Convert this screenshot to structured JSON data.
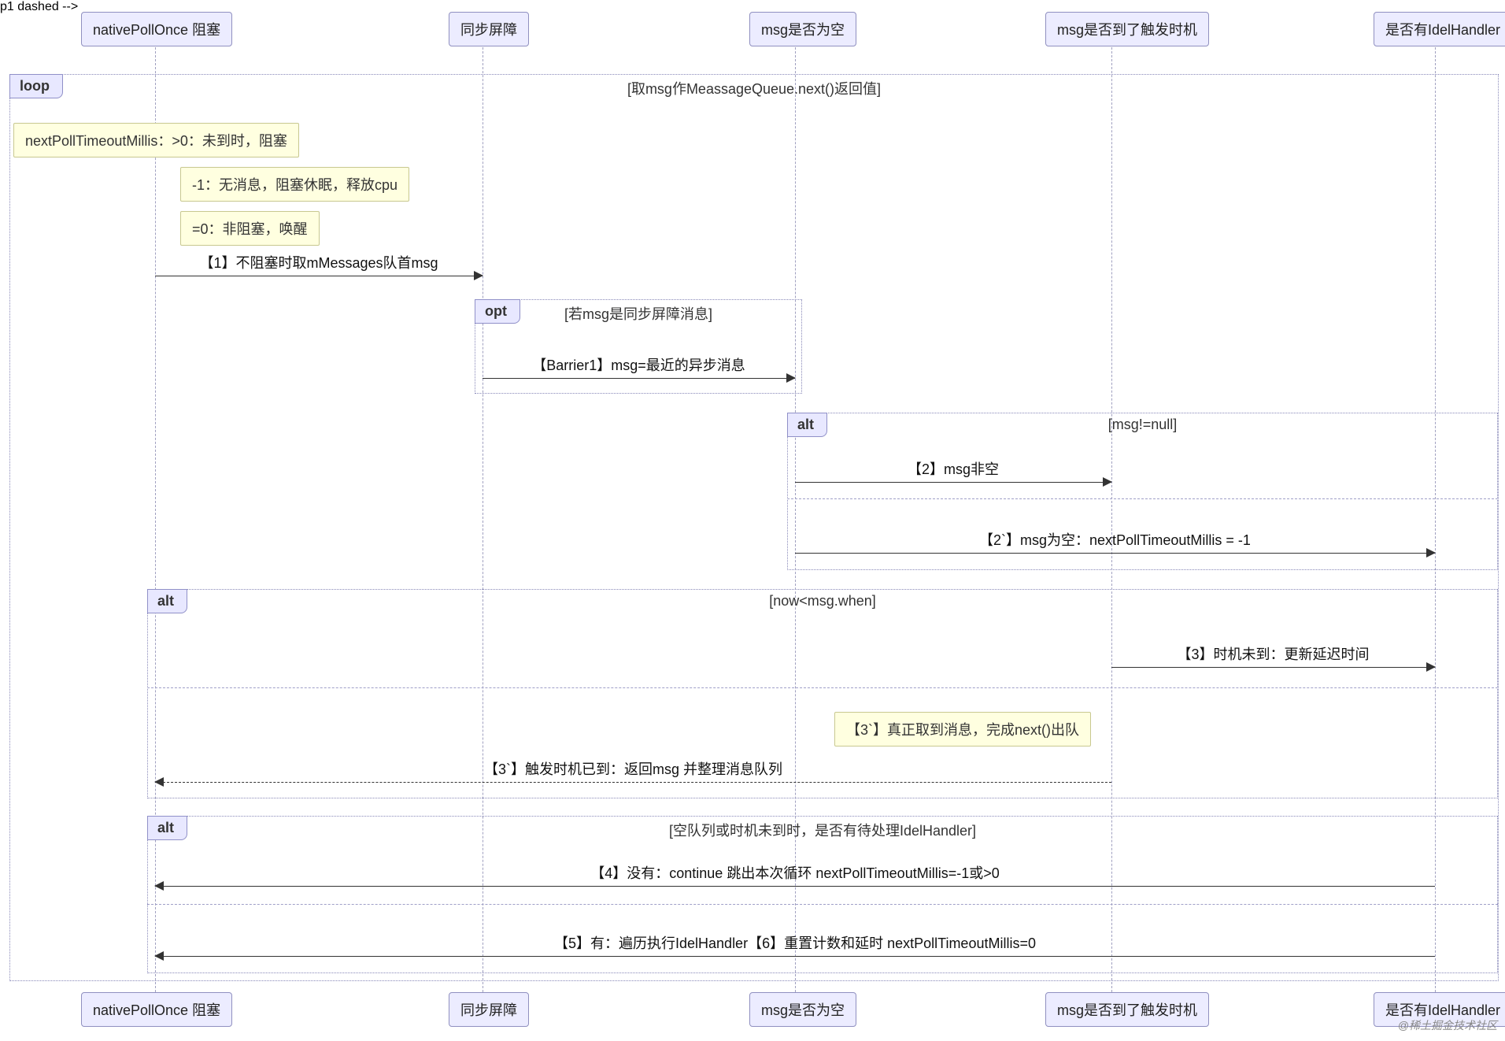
{
  "participants": {
    "p1": "nativePollOnce 阻塞",
    "p2": "同步屏障",
    "p3": "msg是否为空",
    "p4": "msg是否到了触发时机",
    "p5": "是否有IdelHandler"
  },
  "loop": {
    "label": "loop",
    "cond": "[取msg作MeassageQueue.next()返回值]"
  },
  "notes": {
    "n1": "nextPollTimeoutMillis：>0：未到时，阻塞",
    "n2": "-1：无消息，阻塞休眠，释放cpu",
    "n3": "=0：非阻塞，唤醒",
    "n3p": "【3`】真正取到消息，完成next()出队"
  },
  "messages": {
    "m1": "【1】不阻塞时取mMessages队首msg",
    "mB1": "【Barrier1】msg=最近的异步消息",
    "m2": "【2】msg非空",
    "m2p": "【2`】msg为空：nextPollTimeoutMillis = -1",
    "m3": "【3】时机未到：更新延迟时间",
    "m3p": "【3`】触发时机已到：返回msg 并整理消息队列",
    "m4": "【4】没有：continue 跳出本次循环 nextPollTimeoutMillis=-1或>0",
    "m5": "【5】有：遍历执行IdelHandler【6】重置计数和延时 nextPollTimeoutMillis=0"
  },
  "frames": {
    "opt": {
      "label": "opt",
      "cond": "[若msg是同步屏障消息]"
    },
    "alt1": {
      "label": "alt",
      "cond": "[msg!=null]"
    },
    "alt2": {
      "label": "alt",
      "cond": "[now<msg.when]"
    },
    "alt3": {
      "label": "alt",
      "cond": "[空队列或时机未到时，是否有待处理IdelHandler]"
    }
  },
  "watermark": "@稀土掘金技术社区"
}
